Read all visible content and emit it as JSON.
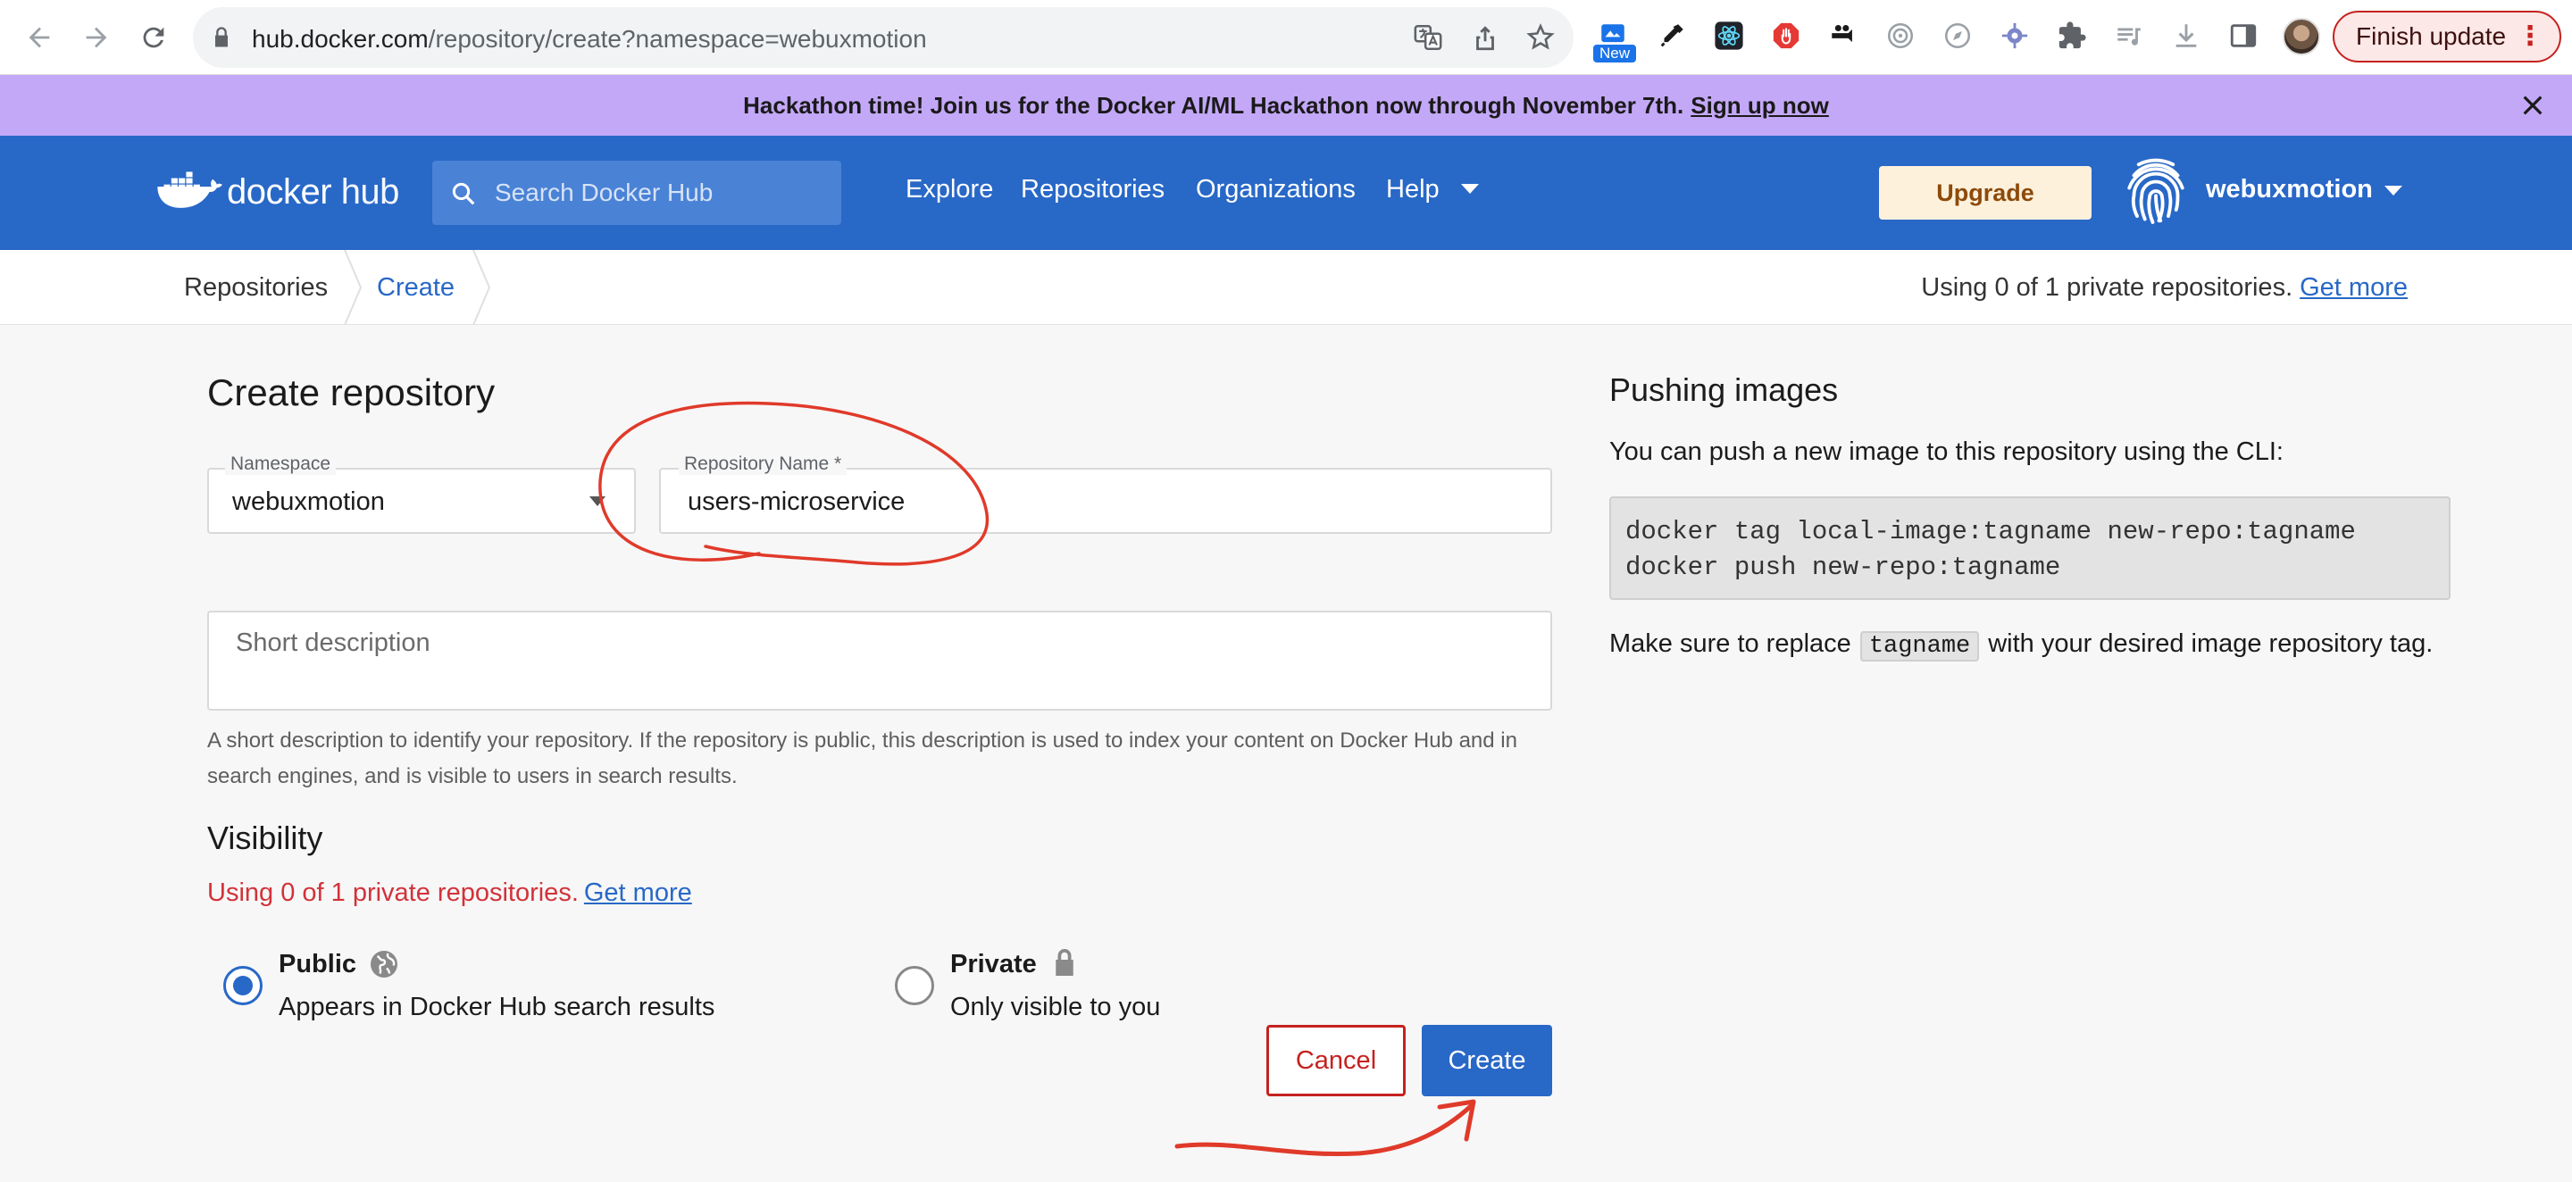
{
  "browser": {
    "url_host": "hub.docker.com",
    "url_path": "/repository/create?namespace=webuxmotion",
    "new_badge": "New",
    "finish_update_label": "Finish update"
  },
  "banner": {
    "text": "Hackathon time! Join us for the Docker AI/ML Hackathon now through November 7th.",
    "link": "Sign up now"
  },
  "header": {
    "logo_docker": "docker",
    "logo_hub": "hub",
    "search_placeholder": "Search Docker Hub",
    "nav": [
      "Explore",
      "Repositories",
      "Organizations",
      "Help"
    ],
    "upgrade_label": "Upgrade",
    "username": "webuxmotion"
  },
  "breadcrumb": {
    "items": [
      "Repositories",
      "Create"
    ],
    "usage_text": "Using 0 of 1 private repositories.",
    "usage_link": "Get more"
  },
  "form": {
    "title": "Create repository",
    "namespace_label": "Namespace",
    "namespace_value": "webuxmotion",
    "repo_name_label": "Repository Name *",
    "repo_name_value": "users-microservice",
    "short_desc_placeholder": "Short description",
    "help_text": "A short description to identify your repository. If the repository is public, this description is used to index your content on Docker Hub and in search engines, and is visible to users in search results.",
    "visibility_heading": "Visibility",
    "usage_warning": "Using 0 of 1 private repositories.",
    "usage_warning_link": "Get more",
    "public_title": "Public",
    "public_sub": "Appears in Docker Hub search results",
    "private_title": "Private",
    "private_sub": "Only visible to you",
    "selected_visibility": "Public",
    "cancel_label": "Cancel",
    "create_label": "Create"
  },
  "push": {
    "heading": "Pushing images",
    "intro": "You can push a new image to this repository using the CLI:",
    "code_line1": "docker tag local-image:tagname new-repo:tagname",
    "code_line2": "docker push new-repo:tagname",
    "note_before": "Make sure to replace",
    "note_code": "tagname",
    "note_after": "with your desired image repository tag."
  },
  "colors": {
    "docker_blue": "#2868c7",
    "banner_purple": "#c4a8f8",
    "annotation_red": "#e03a2a",
    "warning_red": "#d2323a"
  },
  "icons": [
    "back-icon",
    "forward-icon",
    "reload-icon",
    "lock-icon",
    "translate-icon",
    "share-icon",
    "star-icon",
    "extensions-icon",
    "download-icon",
    "close-icon",
    "search-icon",
    "docker-whale-icon",
    "fingerprint-icon",
    "globe-icon",
    "padlock-icon"
  ]
}
